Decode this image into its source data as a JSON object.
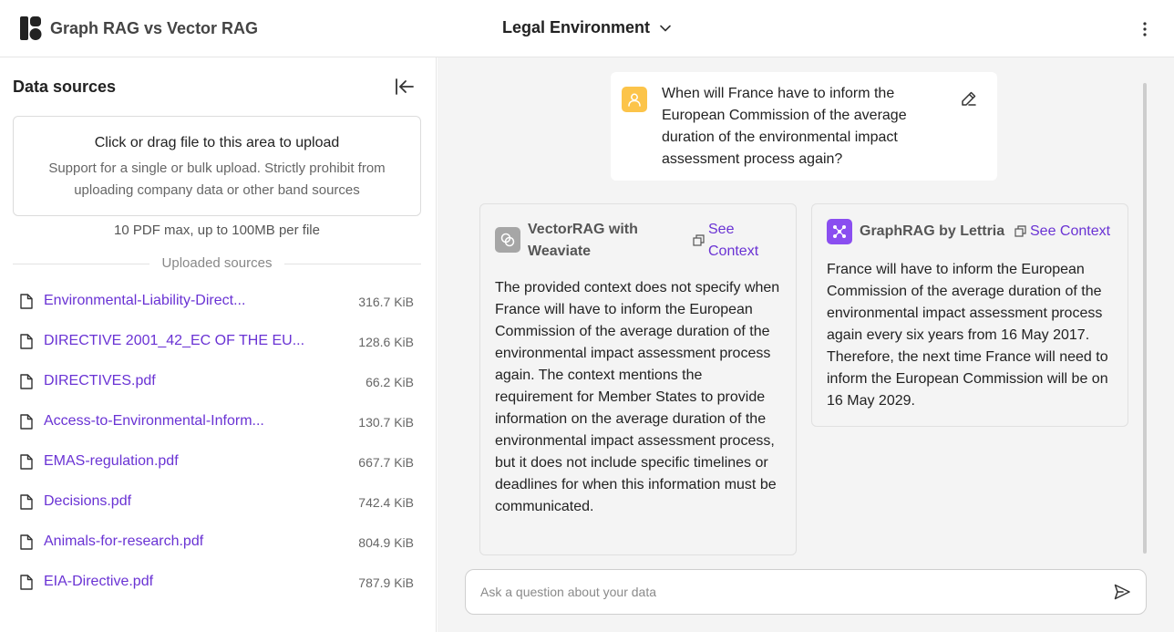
{
  "app": {
    "title": "Graph RAG vs Vector RAG"
  },
  "header": {
    "environment": "Legal Environment"
  },
  "sidebar": {
    "title": "Data sources",
    "upload": {
      "title": "Click or drag file to this area to upload",
      "subtitle": "Support for a single or bulk upload. Strictly prohibit from uploading company data or other band sources",
      "limit": "10 PDF max, up to 100MB per file"
    },
    "uploaded_label": "Uploaded sources",
    "files": [
      {
        "name": "Environmental-Liability-Direct...",
        "size": "316.7 KiB"
      },
      {
        "name": "DIRECTIVE 2001_42_EC OF THE EU...",
        "size": "128.6 KiB"
      },
      {
        "name": "DIRECTIVES.pdf",
        "size": "66.2 KiB"
      },
      {
        "name": "Access-to-Environmental-Inform...",
        "size": "130.7 KiB"
      },
      {
        "name": "EMAS-regulation.pdf",
        "size": "667.7 KiB"
      },
      {
        "name": "Decisions.pdf",
        "size": "742.4 KiB"
      },
      {
        "name": "Animals-for-research.pdf",
        "size": "804.9 KiB"
      },
      {
        "name": "EIA-Directive.pdf",
        "size": "787.9 KiB"
      }
    ]
  },
  "chat": {
    "question": "When will France have to inform the European Commission of the average duration of the environmental impact assessment process again?",
    "vector": {
      "name": "VectorRAG with Weaviate",
      "see_context": "See Context",
      "answer": "The provided context does not specify when France will have to inform the European Commission of the average duration of the environmental impact assessment process again. The context mentions the requirement for Member States to provide information on the average duration of the environmental impact assessment process, but it does not include specific timelines or deadlines for when this information must be communicated."
    },
    "graph": {
      "name": "GraphRAG by Lettria",
      "see_context": "See Context",
      "answer": "France will have to inform the European Commission of the average duration of the environmental impact assessment process again every six years from 16 May 2017. Therefore, the next time France will need to inform the European Commission will be on 16 May 2029."
    },
    "input": {
      "placeholder": "Ask a question about your data",
      "value": ""
    }
  },
  "colors": {
    "accent": "#6a33d4",
    "user_avatar": "#fcc44a",
    "graph_icon": "#8a4ef0",
    "vector_icon": "#a6a6a6"
  },
  "icons": {
    "logo": "logo-icon",
    "chevron": "chevron-down-icon",
    "menu": "kebab-menu-icon",
    "collapse": "collapse-sidebar-icon",
    "file": "file-icon",
    "user": "user-icon",
    "edit": "edit-icon",
    "copy": "copy-icon",
    "send": "send-icon"
  }
}
